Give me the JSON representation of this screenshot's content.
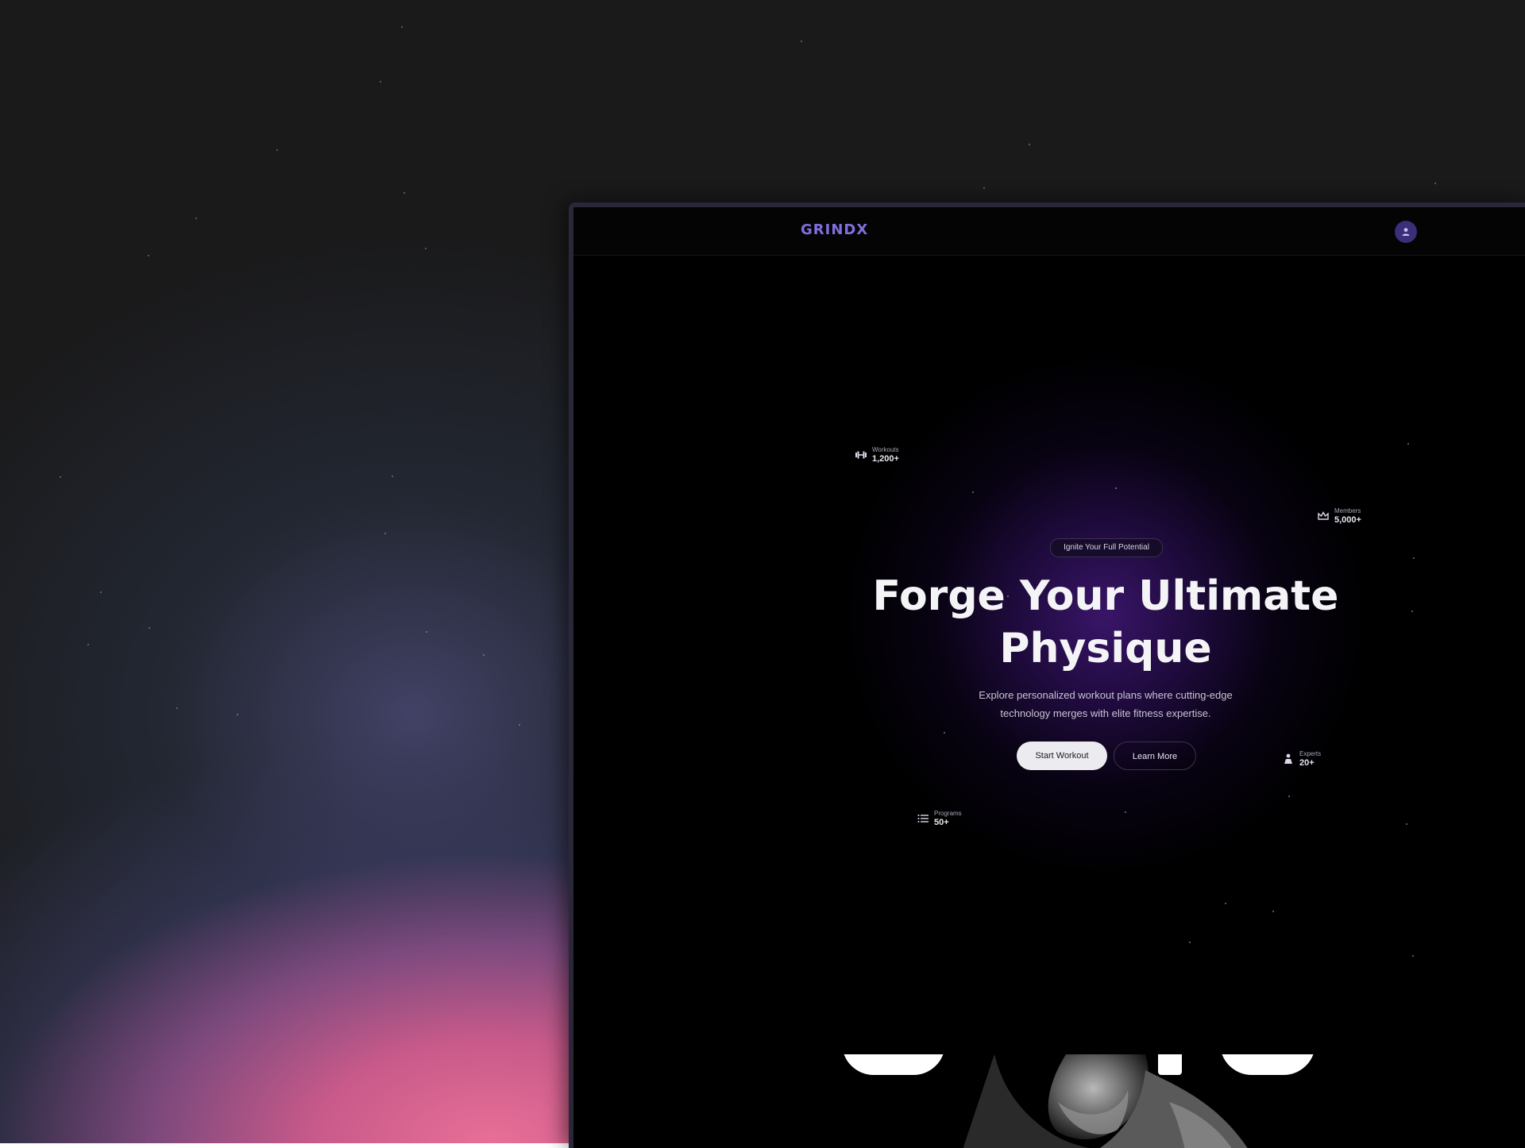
{
  "brand": {
    "logo": "GRINDX",
    "accent_color": "#7f6fe0"
  },
  "navbar": {
    "profile_icon": "user-icon"
  },
  "hero": {
    "badge": "Ignite Your Full Potential",
    "headline_line1": "Forge Your Ultimate",
    "headline_line2": "Physique",
    "subtext_line1": "Explore personalized workout plans where cutting-edge",
    "subtext_line2": "technology merges with elite fitness expertise.",
    "primary_button": "Start Workout",
    "secondary_button": "Learn More"
  },
  "stats": [
    {
      "icon": "dumbbell-icon",
      "label": "Workouts",
      "value": "1,200+"
    },
    {
      "icon": "crown-icon",
      "label": "Members",
      "value": "5,000+"
    },
    {
      "icon": "trainer-icon",
      "label": "Experts",
      "value": "20+"
    },
    {
      "icon": "list-icon",
      "label": "Programs",
      "value": "50+"
    }
  ],
  "colors": {
    "page_background": "#1a1a1b",
    "gradient_pink": "#e86f97",
    "hero_glow": "#3c166e",
    "primary_button_bg": "#ecebf0"
  }
}
